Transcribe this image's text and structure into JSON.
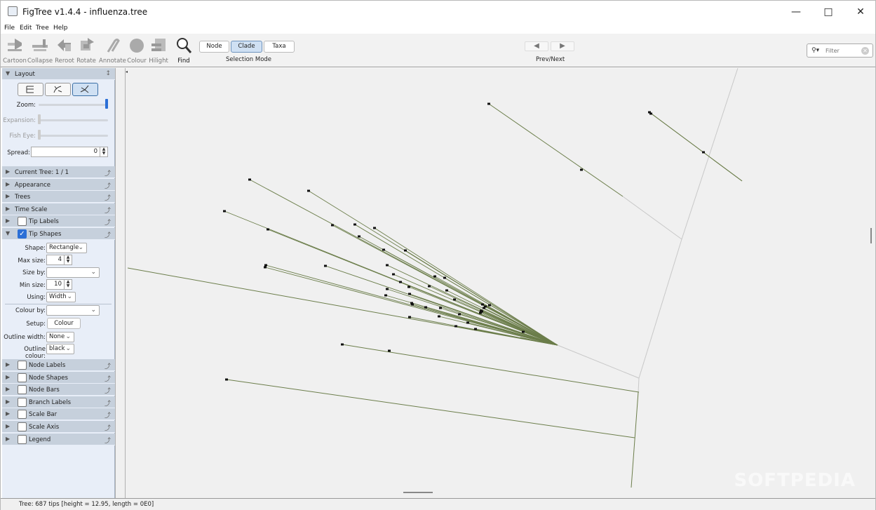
{
  "window": {
    "title": "FigTree v1.4.4 - influenza.tree"
  },
  "menu": [
    "File",
    "Edit",
    "Tree",
    "Help"
  ],
  "toolbar": {
    "buttons": [
      {
        "label": "Cartoon",
        "icon": "cartoon-icon",
        "enabled": false
      },
      {
        "label": "Collapse",
        "icon": "collapse-icon",
        "enabled": false
      },
      {
        "label": "Reroot",
        "icon": "reroot-icon",
        "enabled": false
      },
      {
        "label": "Rotate",
        "icon": "rotate-icon",
        "enabled": false
      },
      {
        "label": "Annotate",
        "icon": "annotate-icon",
        "enabled": false
      },
      {
        "label": "Colour",
        "icon": "colour-icon",
        "enabled": false
      },
      {
        "label": "Hilight",
        "icon": "hilight-icon",
        "enabled": false
      },
      {
        "label": "Find",
        "icon": "find-icon",
        "enabled": true
      }
    ],
    "selection_modes": [
      "Node",
      "Clade",
      "Taxa"
    ],
    "selected_mode": "Clade",
    "selection_mode_label": "Selection Mode",
    "prev_next_label": "Prev/Next",
    "filter_placeholder": "Filter"
  },
  "sidebar": {
    "layout_title": "Layout",
    "zoom_label": "Zoom:",
    "expansion_label": "Expansion:",
    "fisheye_label": "Fish Eye:",
    "spread_label": "Spread:",
    "spread_value": "0",
    "zoom_level": 1.0,
    "sections_top": [
      {
        "name": "Current Tree: 1 / 1",
        "checkbox": false
      },
      {
        "name": "Appearance",
        "checkbox": false
      },
      {
        "name": "Trees",
        "checkbox": false
      },
      {
        "name": "Time Scale",
        "checkbox": false
      },
      {
        "name": "Tip Labels",
        "checkbox": true,
        "checked": false
      },
      {
        "name": "Tip Shapes",
        "checkbox": true,
        "checked": true
      }
    ],
    "tip_shapes": {
      "shape_label": "Shape:",
      "shape_value": "Rectangle",
      "max_size_label": "Max size:",
      "max_size_value": "4",
      "size_by_label": "Size by:",
      "size_by_value": "",
      "min_size_label": "Min size:",
      "min_size_value": "10",
      "using_label": "Using:",
      "using_value": "Width",
      "colour_by_label": "Colour by:",
      "colour_by_value": "",
      "setup_label": "Setup:",
      "setup_button": "Colour",
      "outline_width_label": "Outline width:",
      "outline_width_value": "None",
      "outline_colour_label": "Outline colour:",
      "outline_colour_value": "black"
    },
    "sections_bottom": [
      {
        "name": "Node Labels",
        "checked": false
      },
      {
        "name": "Node Shapes",
        "checked": false
      },
      {
        "name": "Node Bars",
        "checked": false
      },
      {
        "name": "Branch Labels",
        "checked": false
      },
      {
        "name": "Scale Bar",
        "checked": false
      },
      {
        "name": "Scale Axis",
        "checked": false
      },
      {
        "name": "Legend",
        "checked": false
      }
    ]
  },
  "status": "Tree: 687 tips [height = 12.95, length = 0E0]",
  "watermark": "SOFTPEDIA",
  "colors": {
    "branch": "#6b7d4a",
    "branch_faint": "#c8c8c8",
    "tip": "#111111",
    "sidebar_bg": "#e8eef8",
    "section_bg": "#c6d0dc",
    "selected": "#cfe0f3"
  }
}
